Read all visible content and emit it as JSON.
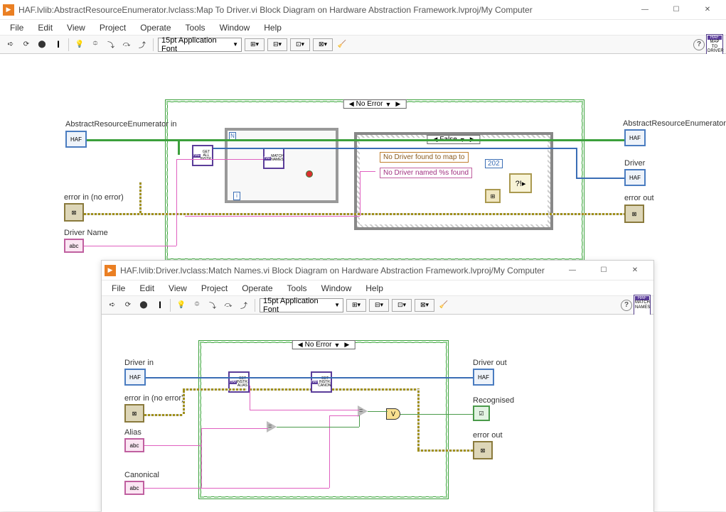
{
  "win1": {
    "title": "HAF.lvlib:AbstractResourceEnumerator.lvclass:Map To Driver.vi Block Diagram on Hardware Abstraction Framework.lvproj/My Computer",
    "menu": [
      "File",
      "Edit",
      "View",
      "Project",
      "Operate",
      "Tools",
      "Window",
      "Help"
    ],
    "font": "15pt Application Font",
    "haf_corner": "MAP TO DRIVER",
    "labels": {
      "in_class": "AbstractResourceEnumerator in",
      "err_in": "error in (no error)",
      "drv_name": "Driver Name",
      "out_class": "AbstractResourceEnumerator",
      "out_driver": "Driver",
      "err_out": "error out"
    },
    "struct_noerr": "No Error",
    "struct_false": "False",
    "sub1": "GET ALL INSTR.",
    "sub2": "MATCH NAMES",
    "msg1": "No Driver found to map to",
    "msg2": "No Driver named %s found",
    "errconst": "202",
    "for_n": "N",
    "for_i": "i"
  },
  "win2": {
    "title": "HAF.lvlib:Driver.lvclass:Match Names.vi Block Diagram on Hardware Abstraction Framework.lvproj/My Computer",
    "menu": [
      "File",
      "Edit",
      "View",
      "Project",
      "Operate",
      "Tools",
      "Window",
      "Help"
    ],
    "font": "15pt Application Font",
    "haf_corner": "MATCH NAMES",
    "labels": {
      "in_class": "Driver in",
      "err_in": "error in (no error)",
      "alias": "Alias",
      "canon": "Canonical",
      "out_class": "Driver out",
      "recog": "Recognised",
      "err_out": "error out"
    },
    "struct_noerr": "No Error",
    "sub1": "GET INSTR. ALIAS",
    "sub2": "GET INSTR. CANON.",
    "or_lbl": "V",
    "eq_lbl": "="
  }
}
